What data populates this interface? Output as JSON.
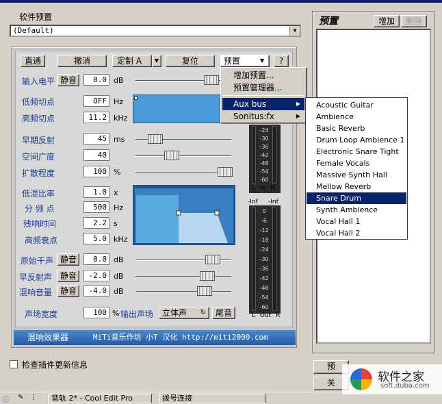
{
  "header": {
    "preset_label": "软件预置",
    "preset_value": "(Default)"
  },
  "toolbar": {
    "direct": "直通",
    "undo": "撤消",
    "custom": "定制 A",
    "reset": "复位",
    "preset": "预置",
    "help": "?"
  },
  "rows": {
    "input_level": {
      "label": "输入电平",
      "mute": "静音",
      "value": "0.0",
      "unit": "dB"
    },
    "low_cut": {
      "label": "低频切点",
      "value": "OFF",
      "unit": "Hz"
    },
    "high_cut": {
      "label": "高频切点",
      "value": "11.2",
      "unit": "kHz"
    },
    "early_ref": {
      "label": "早期反射",
      "value": "45",
      "unit": "ms"
    },
    "space_width": {
      "label": "空间广度",
      "value": "40",
      "unit": ""
    },
    "diffusion": {
      "label": "扩散程度",
      "value": "100",
      "unit": "%"
    },
    "bass_ratio": {
      "label": "低混比率",
      "value": "1.0",
      "unit": "x"
    },
    "crossover": {
      "label": "分 频 点",
      "value": "500",
      "unit": "Hz"
    },
    "decay": {
      "label": "残响时间",
      "value": "2.2",
      "unit": "s"
    },
    "high_damp": {
      "label": "高频衰点",
      "value": "5.0",
      "unit": "kHz"
    },
    "dry": {
      "label": "原始干声",
      "mute": "静音",
      "value": "0.0",
      "unit": "dB"
    },
    "early": {
      "label": "早反射声",
      "mute": "静音",
      "value": "-2.0",
      "unit": "dB"
    },
    "reverb": {
      "label": "混响音量",
      "mute": "静音",
      "value": "-4.0",
      "unit": "dB"
    },
    "stereo_width": {
      "label": "声场宽度",
      "value": "100",
      "unit": "%"
    }
  },
  "output": {
    "label": "输出声场",
    "value": "立体声",
    "tail": "尾音"
  },
  "meters": {
    "in_scale": [
      "-24",
      "-30",
      "-36",
      "-42",
      "-48",
      "-54",
      "-60"
    ],
    "in_labels": [
      "L",
      "In",
      "R"
    ],
    "out_top": [
      "-Inf",
      "-Inf"
    ],
    "out_scale": [
      "0",
      "-6",
      "-12",
      "-18",
      "-24",
      "-30",
      "-36",
      "-42",
      "-48",
      "-54",
      "-60"
    ],
    "out_labels": [
      "L",
      "Out",
      "R"
    ]
  },
  "footer": {
    "left": "混响效果器",
    "right": "MiTi音乐作坊 小T 汉化 http://miti2000.com"
  },
  "right_panel": {
    "title": "预置",
    "add": "增加",
    "delete": "删除"
  },
  "menu1": {
    "add_preset": "增加预置...",
    "manage_preset": "预置管理器...",
    "aux_bus": "Aux bus",
    "sonitus": "Sonitus:fx"
  },
  "menu2": [
    "Acoustic Guitar",
    "Ambience",
    "Basic Reverb",
    "Drum Loop Ambience 1",
    "Electronic Snare Tight",
    "Female Vocals",
    "Massive Synth Hall",
    "Mellow Reverb",
    "Snare Drum",
    "Synth Ambience",
    "Vocal Hall 1",
    "Vocal Hall 2"
  ],
  "menu2_selected": "Snare Drum",
  "check_updates": "检查插件更新信息",
  "bottom_buttons": {
    "b1": "预",
    "b2": "关"
  },
  "taskbar": {
    "t1": "音轨 2* - Cool Edit Pro",
    "t2": "拨号连接"
  },
  "watermark": {
    "name": "软件之家",
    "url": "soft.duba.com"
  },
  "colors": {
    "accent": "#0a246a",
    "label_blue": "#1a3c9a",
    "graph_fill": "#4a9ad8"
  }
}
